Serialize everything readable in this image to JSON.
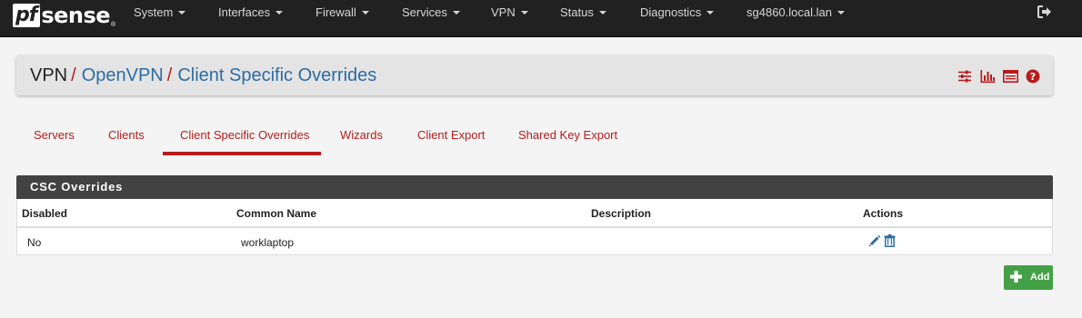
{
  "navbar": {
    "brand": {
      "pf": "pf",
      "sense": "sense",
      "reg": "®"
    },
    "items": [
      {
        "label": "System"
      },
      {
        "label": "Interfaces"
      },
      {
        "label": "Firewall"
      },
      {
        "label": "Services"
      },
      {
        "label": "VPN"
      },
      {
        "label": "Status"
      },
      {
        "label": "Diagnostics"
      },
      {
        "label": "sg4860.local.lan"
      }
    ],
    "logout_icon": "logout-icon"
  },
  "breadcrumb": {
    "items": [
      "VPN",
      "OpenVPN",
      "Client Specific Overrides"
    ],
    "separator": "/",
    "icons": [
      "sliders-icon",
      "bar-chart-icon",
      "list-log-icon",
      "help-icon"
    ]
  },
  "tabs": [
    {
      "label": "Servers",
      "active": false
    },
    {
      "label": "Clients",
      "active": false
    },
    {
      "label": "Client Specific Overrides",
      "active": true
    },
    {
      "label": "Wizards",
      "active": false
    },
    {
      "label": "Client Export",
      "active": false
    },
    {
      "label": "Shared Key Export",
      "active": false
    }
  ],
  "panel": {
    "title": "CSC Overrides",
    "columns": [
      "Disabled",
      "Common Name",
      "Description",
      "Actions"
    ],
    "rows": [
      {
        "disabled": "No",
        "common_name": "worklaptop",
        "description": "",
        "actions": [
          "edit-icon",
          "delete-icon"
        ]
      }
    ]
  },
  "add_button": {
    "label": "Add",
    "icon": "plus-icon"
  },
  "colors": {
    "navbar_bg": "#212121",
    "accent_red": "#b71c1c",
    "link_blue": "#2b6ca3",
    "panel_head": "#424242",
    "add_green": "#43a047"
  }
}
